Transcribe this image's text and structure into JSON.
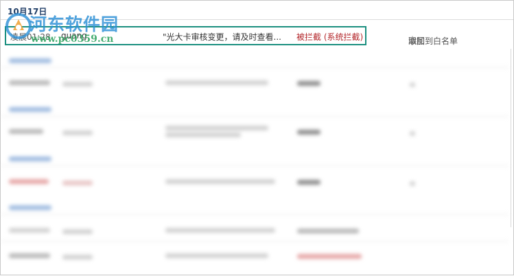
{
  "date_header": "10月17日",
  "highlighted_record": {
    "time": "凌晨01:28",
    "sender": "guang",
    "content": "\"光大卡审核变更，请及时查看...",
    "status": "被拦截 (系统拦截)"
  },
  "row_actions": {
    "whitelist_label": "添加到白名单",
    "separator": "|",
    "cancel_label": "取回"
  },
  "watermark": {
    "title": "河东软件园",
    "url": "www.pc0359.cn"
  },
  "colors": {
    "date_header": "#1f3d66",
    "status_blocked": "#b3262a",
    "highlight_border": "#1a8f7f",
    "watermark_blue": "#2b8fd6",
    "watermark_green": "#2aa15b"
  }
}
